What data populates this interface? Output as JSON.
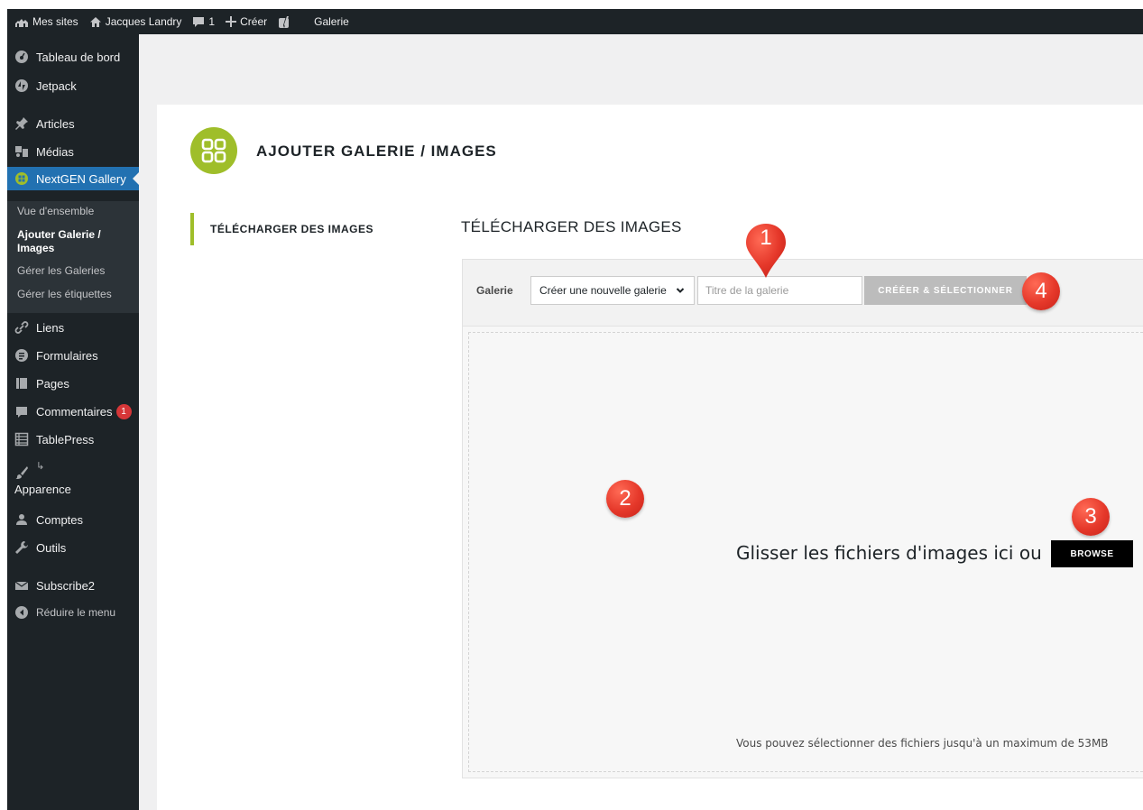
{
  "admin_bar": {
    "my_sites": "Mes sites",
    "site_name": "Jacques Landry",
    "comments_count": "1",
    "create": "Créer",
    "gallery_link": "Galerie"
  },
  "sidebar": {
    "items": [
      {
        "label": "Tableau de bord",
        "icon": "dashboard-icon"
      },
      {
        "label": "Jetpack",
        "icon": "jetpack-icon"
      },
      {
        "label": "Articles",
        "icon": "pin-icon"
      },
      {
        "label": "Médias",
        "icon": "media-icon"
      },
      {
        "label": "NextGEN Gallery",
        "icon": "nextgen-icon"
      },
      {
        "label": "Liens",
        "icon": "link-icon"
      },
      {
        "label": "Formulaires",
        "icon": "forms-icon"
      },
      {
        "label": "Pages",
        "icon": "pages-icon"
      },
      {
        "label": "Commentaires",
        "icon": "comment-icon",
        "badge": "1"
      },
      {
        "label": "TablePress",
        "icon": "table-icon"
      },
      {
        "label": "Apparence",
        "icon": "brush-icon",
        "prefix": "↳"
      },
      {
        "label": "Comptes",
        "icon": "users-icon"
      },
      {
        "label": "Outils",
        "icon": "wrench-icon"
      },
      {
        "label": "Subscribe2",
        "icon": "subscribe-icon"
      },
      {
        "label": "Réduire le menu",
        "icon": "collapse-icon"
      }
    ],
    "submenu": [
      {
        "label": "Vue d'ensemble"
      },
      {
        "label": "Ajouter Galerie /"
      },
      {
        "label": "Images"
      },
      {
        "label": "Gérer les Galeries"
      },
      {
        "label": "Gérer les étiquettes"
      }
    ]
  },
  "page": {
    "title": "AJOUTER GALERIE / IMAGES",
    "left_tab": "TÉLÉCHARGER DES IMAGES",
    "section_title": "TÉLÉCHARGER DES IMAGES",
    "gallery_label": "Galerie",
    "gallery_select_value": "Créer une nouvelle galerie",
    "gallery_title_placeholder": "Titre de la galerie",
    "create_select_label": "CRÉÉER & SÉLECTIONNER",
    "drop_text": "Glisser les fichiers d'images ici ou",
    "browse_label": "BROWSE",
    "max_size_text": "Vous pouvez sélectionner des fichiers jusqu'à un maximum de 53MB"
  },
  "annotations": {
    "marker_1": "1",
    "marker_2": "2",
    "marker_3": "3",
    "marker_4": "4"
  },
  "colors": {
    "admin_dark": "#1d2327",
    "active_blue": "#2271b1",
    "nextgen_green": "#9fbe2a",
    "badge_red": "#d63638",
    "marker_red": "#e5382a"
  }
}
